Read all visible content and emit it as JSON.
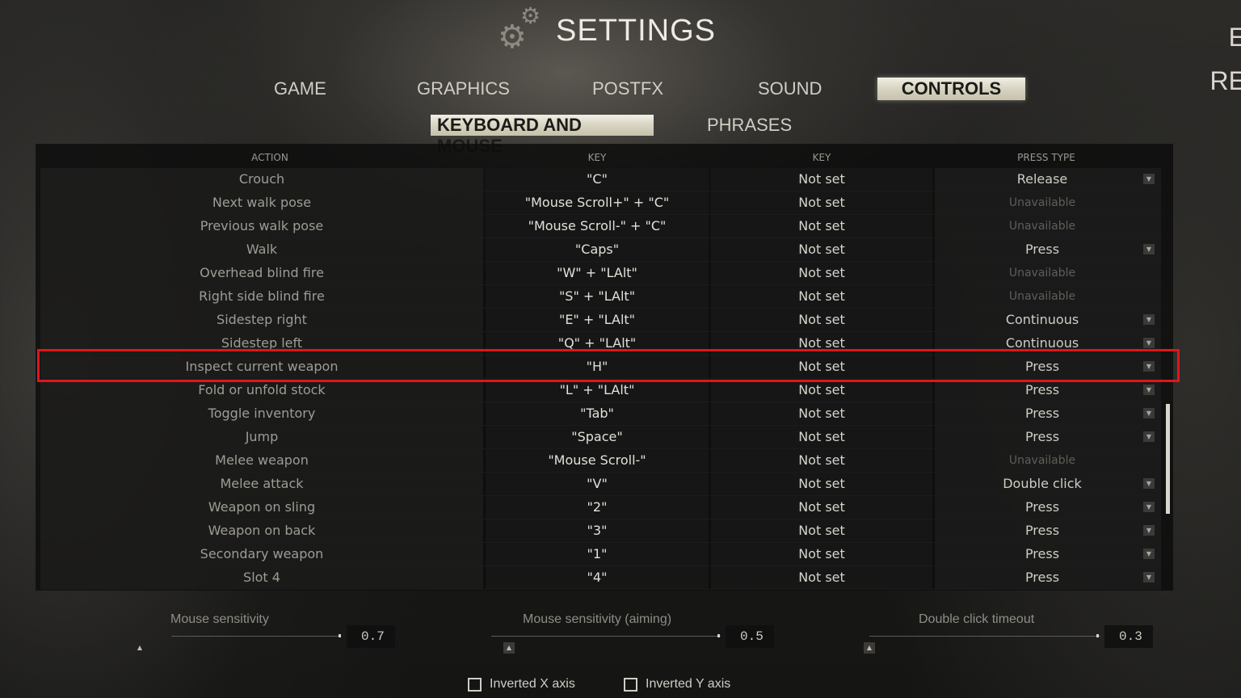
{
  "header": {
    "title": "SETTINGS",
    "icon": "gears-icon",
    "edge_right_1": "E",
    "edge_right_2": "RE"
  },
  "tabs": [
    {
      "label": "GAME",
      "active": false
    },
    {
      "label": "GRAPHICS",
      "active": false
    },
    {
      "label": "POSTFX",
      "active": false
    },
    {
      "label": "SOUND",
      "active": false
    },
    {
      "label": "CONTROLS",
      "active": true
    }
  ],
  "subtabs": [
    {
      "label": "KEYBOARD AND MOUSE",
      "active": true
    },
    {
      "label": "PHRASES",
      "active": false
    }
  ],
  "table": {
    "headers": {
      "action": "ACTION",
      "key1": "KEY",
      "key2": "KEY",
      "press_type": "PRESS TYPE"
    },
    "rows": [
      {
        "action": "Crouch",
        "key1": "\"C\"",
        "key2": "Not set",
        "press": "Release",
        "dropdown": true
      },
      {
        "action": "Next walk pose",
        "key1": "\"Mouse Scroll+\" + \"C\"",
        "key2": "Not set",
        "press": "Unavailable",
        "dropdown": false
      },
      {
        "action": "Previous walk pose",
        "key1": "\"Mouse Scroll-\" + \"C\"",
        "key2": "Not set",
        "press": "Unavailable",
        "dropdown": false
      },
      {
        "action": "Walk",
        "key1": "\"Caps\"",
        "key2": "Not set",
        "press": "Press",
        "dropdown": true
      },
      {
        "action": "Overhead blind fire",
        "key1": "\"W\" + \"LAlt\"",
        "key2": "Not set",
        "press": "Unavailable",
        "dropdown": false
      },
      {
        "action": "Right side blind fire",
        "key1": "\"S\" + \"LAlt\"",
        "key2": "Not set",
        "press": "Unavailable",
        "dropdown": false
      },
      {
        "action": "Sidestep right",
        "key1": "\"E\" + \"LAlt\"",
        "key2": "Not set",
        "press": "Continuous",
        "dropdown": true
      },
      {
        "action": "Sidestep left",
        "key1": "\"Q\" + \"LAlt\"",
        "key2": "Not set",
        "press": "Continuous",
        "dropdown": true
      },
      {
        "action": "Inspect current weapon",
        "key1": "\"H\"",
        "key2": "Not set",
        "press": "Press",
        "dropdown": true
      },
      {
        "action": "Fold or unfold stock",
        "key1": "\"L\" + \"LAlt\"",
        "key2": "Not set",
        "press": "Press",
        "dropdown": true
      },
      {
        "action": "Toggle inventory",
        "key1": "\"Tab\"",
        "key2": "Not set",
        "press": "Press",
        "dropdown": true
      },
      {
        "action": "Jump",
        "key1": "\"Space\"",
        "key2": "Not set",
        "press": "Press",
        "dropdown": true
      },
      {
        "action": "Melee weapon",
        "key1": "\"Mouse Scroll-\"",
        "key2": "Not set",
        "press": "Unavailable",
        "dropdown": false
      },
      {
        "action": "Melee attack",
        "key1": "\"V\"",
        "key2": "Not set",
        "press": "Double click",
        "dropdown": true
      },
      {
        "action": "Weapon on sling",
        "key1": "\"2\"",
        "key2": "Not set",
        "press": "Press",
        "dropdown": true
      },
      {
        "action": "Weapon on back",
        "key1": "\"3\"",
        "key2": "Not set",
        "press": "Press",
        "dropdown": true
      },
      {
        "action": "Secondary weapon",
        "key1": "\"1\"",
        "key2": "Not set",
        "press": "Press",
        "dropdown": true
      },
      {
        "action": "Slot 4",
        "key1": "\"4\"",
        "key2": "Not set",
        "press": "Press",
        "dropdown": true
      }
    ]
  },
  "sliders": [
    {
      "label": "Mouse sensitivity",
      "value": "0.7"
    },
    {
      "label": "Mouse sensitivity (aiming)",
      "value": "0.5"
    },
    {
      "label": "Double click timeout",
      "value": "0.3"
    }
  ],
  "checkboxes": [
    {
      "label": "Inverted X axis",
      "checked": false
    },
    {
      "label": "Inverted Y axis",
      "checked": false
    }
  ],
  "colors": {
    "accent_tab": "#d8d4c2",
    "highlight": "#e0161a"
  }
}
